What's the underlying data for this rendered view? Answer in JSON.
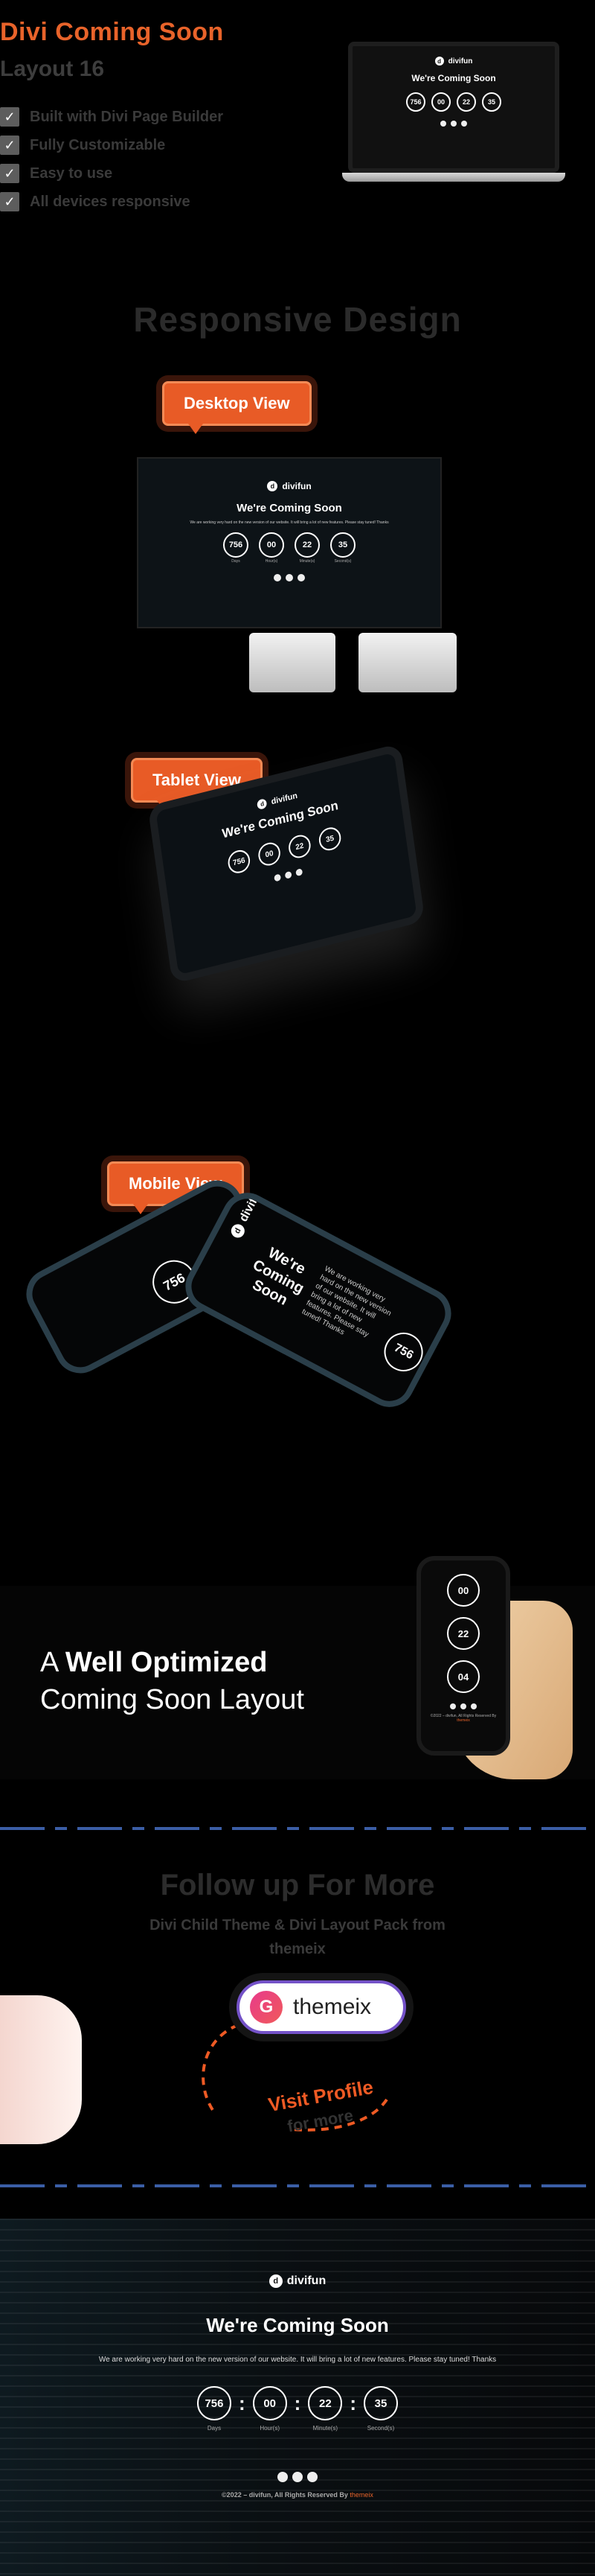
{
  "header": {
    "title": "Divi Coming Soon",
    "subtitle": "Layout 16",
    "features": [
      "Built with Divi Page Builder",
      "Fully Customizable",
      "Easy to use",
      "All devices responsive"
    ]
  },
  "responsive": {
    "title": "Responsive Design",
    "desktop_label": "Desktop View",
    "tablet_label": "Tablet View",
    "mobile_label": "Mobile View"
  },
  "preview": {
    "brand": "divifun",
    "brand_initial": "d",
    "title": "We're Coming Soon",
    "description": "We are working very hard on the new version of our website. It will bring a lot of new features. Please stay tuned! Thanks",
    "countdown": [
      {
        "value": "756",
        "label": "Days"
      },
      {
        "value": "00",
        "label": "Hour(s)"
      },
      {
        "value": "22",
        "label": "Minute(s)"
      },
      {
        "value": "35",
        "label": "Second(s)"
      }
    ],
    "mobile_extra": "04",
    "copyright": "©2022 – divifun, All Rights Reserved By",
    "copyright_link": "themeix",
    "mobile_text": "We are working very hard on the new version of our website. It will bring a lot of new features. Please stay tuned! Thanks"
  },
  "optimized": {
    "line1_normal": "A ",
    "line1_bold": "Well Optimized",
    "line2": "Coming Soon Layout"
  },
  "follow": {
    "title": "Follow up For More",
    "subtitle_line1": "Divi Child Theme & Divi Layout Pack from",
    "subtitle_line2": "themeix",
    "brand_name": "themeix",
    "brand_initial": "G",
    "visit_label": "Visit Profile",
    "for_more": "for more"
  },
  "colors": {
    "accent": "#e8632a",
    "brand_purple": "#7452c8",
    "dash_blue": "#3b5ea6"
  }
}
